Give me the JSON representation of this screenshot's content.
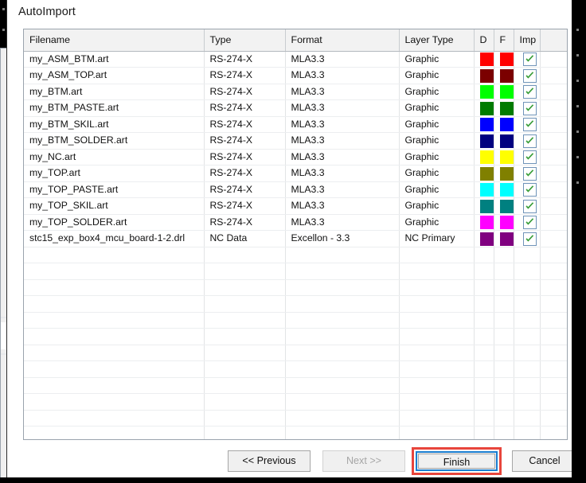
{
  "dialog": {
    "title": "AutoImport"
  },
  "grid": {
    "headers": [
      "Filename",
      "Type",
      "Format",
      "Layer Type",
      "D",
      "F",
      "Imp",
      ""
    ],
    "rows": [
      {
        "filename": "my_ASM_BTM.art",
        "type": "RS-274-X",
        "format": "MLA3.3",
        "layer_type": "Graphic",
        "d_color": "#FF0000",
        "f_color": "#FF0000",
        "imp": true
      },
      {
        "filename": "my_ASM_TOP.art",
        "type": "RS-274-X",
        "format": "MLA3.3",
        "layer_type": "Graphic",
        "d_color": "#7B0000",
        "f_color": "#7B0000",
        "imp": true
      },
      {
        "filename": "my_BTM.art",
        "type": "RS-274-X",
        "format": "MLA3.3",
        "layer_type": "Graphic",
        "d_color": "#00FF00",
        "f_color": "#00FF00",
        "imp": true
      },
      {
        "filename": "my_BTM_PASTE.art",
        "type": "RS-274-X",
        "format": "MLA3.3",
        "layer_type": "Graphic",
        "d_color": "#007B00",
        "f_color": "#007B00",
        "imp": true
      },
      {
        "filename": "my_BTM_SKIL.art",
        "type": "RS-274-X",
        "format": "MLA3.3",
        "layer_type": "Graphic",
        "d_color": "#0000FF",
        "f_color": "#0000FF",
        "imp": true
      },
      {
        "filename": "my_BTM_SOLDER.art",
        "type": "RS-274-X",
        "format": "MLA3.3",
        "layer_type": "Graphic",
        "d_color": "#000080",
        "f_color": "#000080",
        "imp": true
      },
      {
        "filename": "my_NC.art",
        "type": "RS-274-X",
        "format": "MLA3.3",
        "layer_type": "Graphic",
        "d_color": "#FFFF00",
        "f_color": "#FFFF00",
        "imp": true
      },
      {
        "filename": "my_TOP.art",
        "type": "RS-274-X",
        "format": "MLA3.3",
        "layer_type": "Graphic",
        "d_color": "#808000",
        "f_color": "#808000",
        "imp": true
      },
      {
        "filename": "my_TOP_PASTE.art",
        "type": "RS-274-X",
        "format": "MLA3.3",
        "layer_type": "Graphic",
        "d_color": "#00FFFF",
        "f_color": "#00FFFF",
        "imp": true
      },
      {
        "filename": "my_TOP_SKIL.art",
        "type": "RS-274-X",
        "format": "MLA3.3",
        "layer_type": "Graphic",
        "d_color": "#008080",
        "f_color": "#008080",
        "imp": true
      },
      {
        "filename": "my_TOP_SOLDER.art",
        "type": "RS-274-X",
        "format": "MLA3.3",
        "layer_type": "Graphic",
        "d_color": "#FF00FF",
        "f_color": "#FF00FF",
        "imp": true
      },
      {
        "filename": "stc15_exp_box4_mcu_board-1-2.drl",
        "type": "NC Data",
        "format": "Excellon - 3.3",
        "layer_type": "NC Primary",
        "d_color": "#800080",
        "f_color": "#800080",
        "imp": true
      }
    ],
    "empty_row_count": 12
  },
  "buttons": {
    "previous": "<< Previous",
    "next": "Next >>",
    "finish": "Finish",
    "cancel": "Cancel",
    "next_disabled": true,
    "finish_focused": true,
    "highlight_color": "#e8453c",
    "focus_color": "#1a7ed1"
  },
  "icons": {
    "checkmark": "check-icon"
  }
}
